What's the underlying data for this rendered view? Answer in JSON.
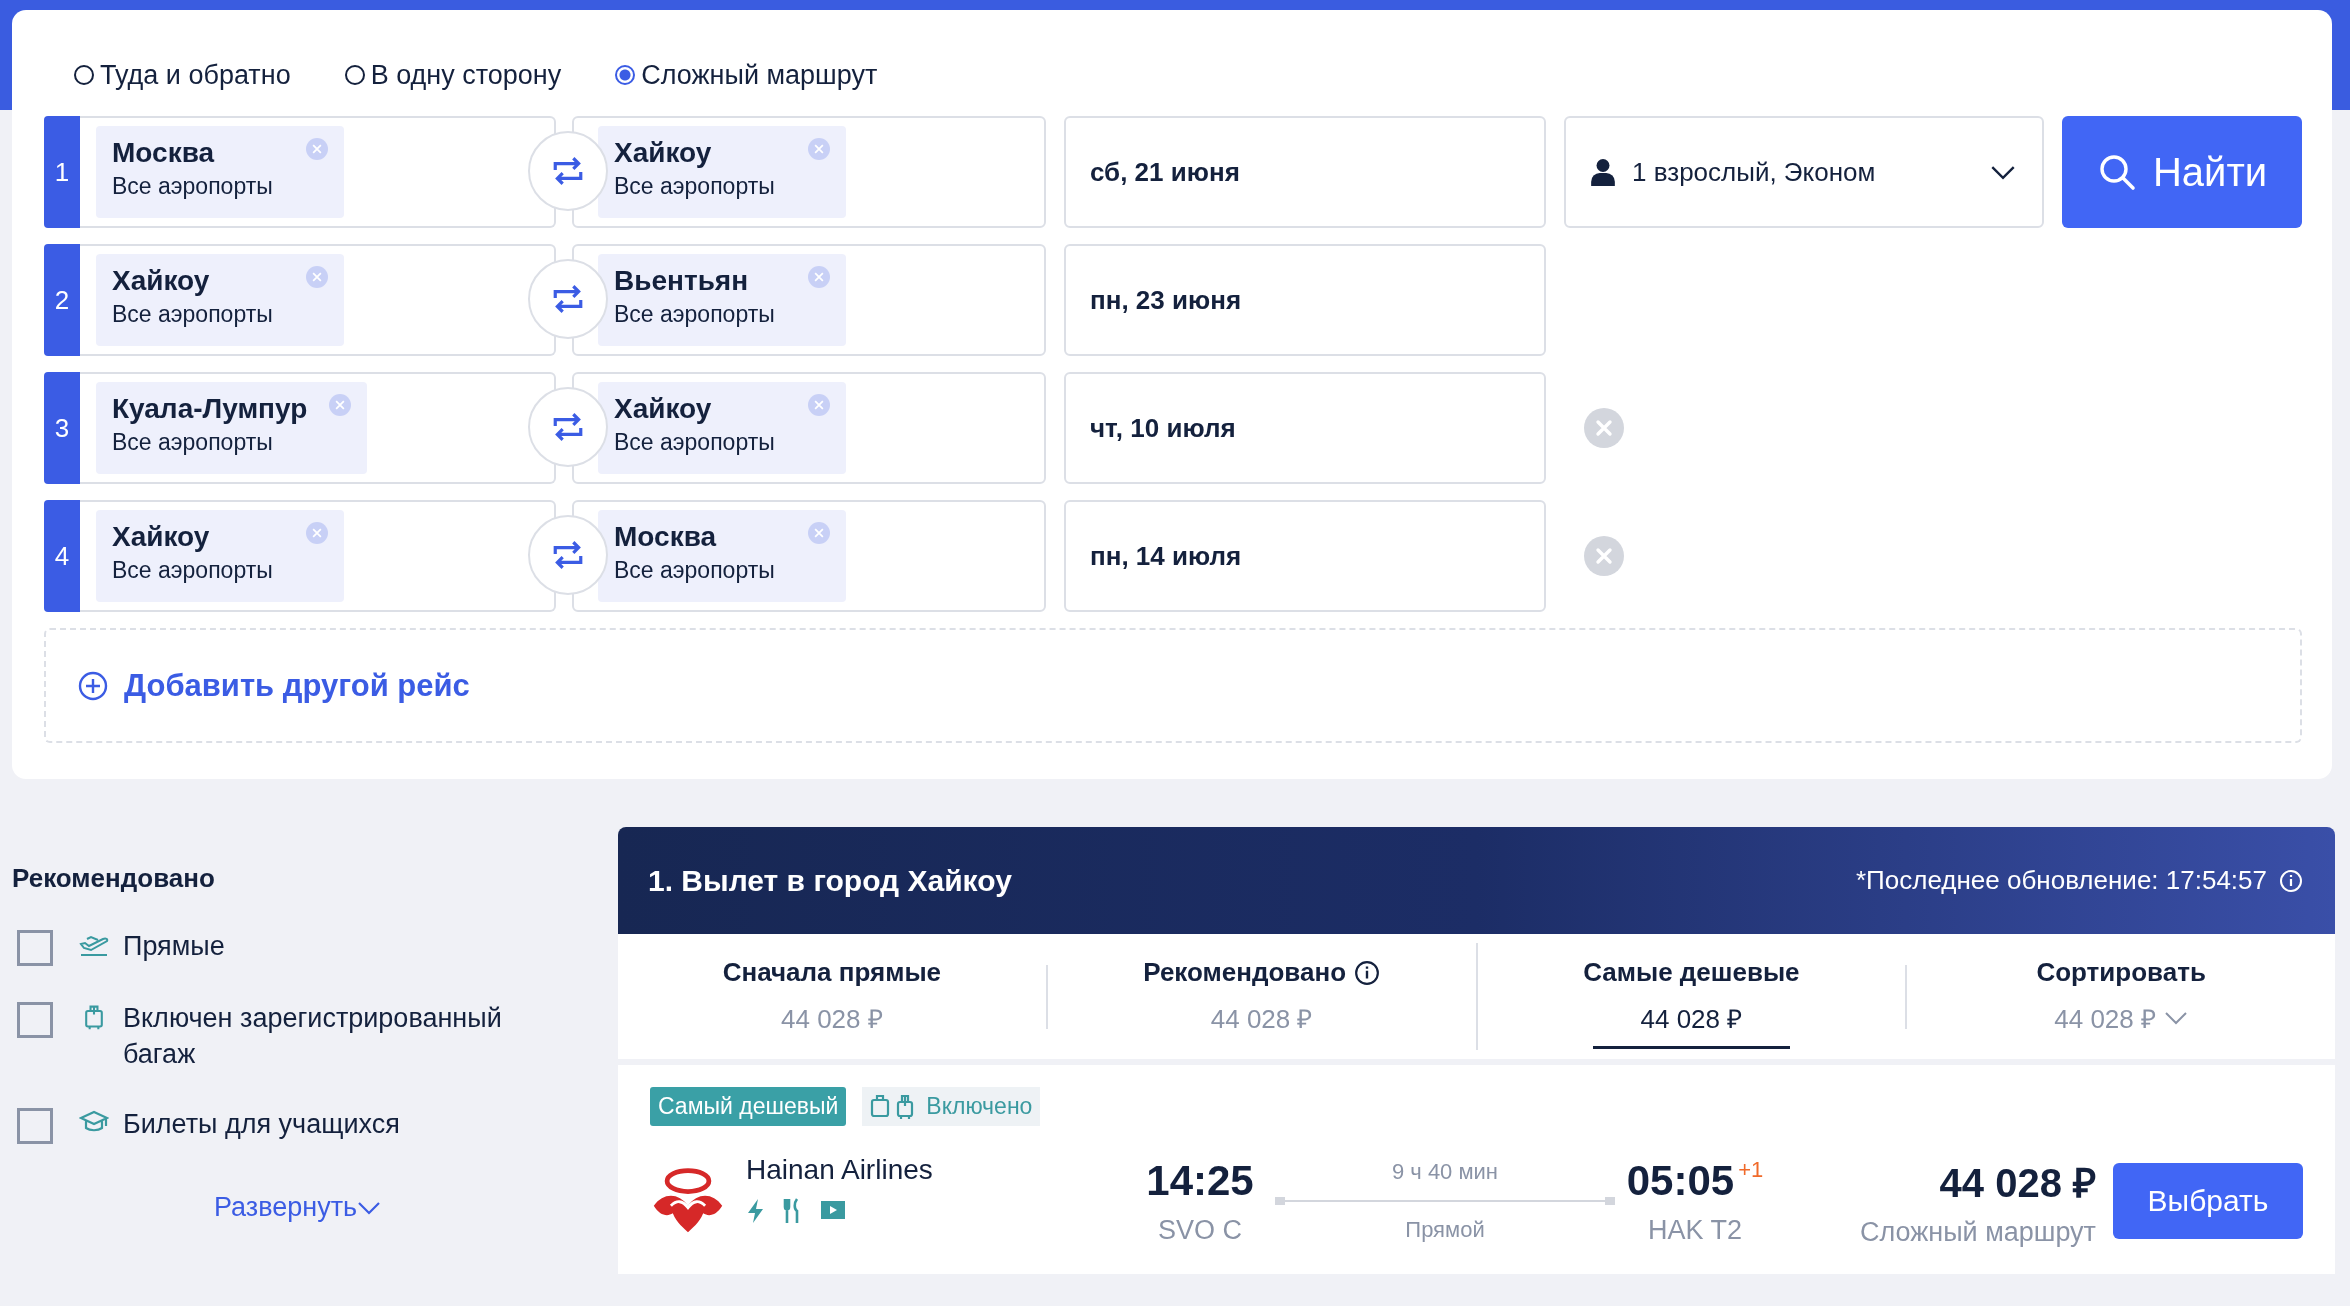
{
  "trip_types": [
    {
      "label": "Туда и обратно",
      "selected": false
    },
    {
      "label": "В одну сторону",
      "selected": false
    },
    {
      "label": "Сложный маршрут",
      "selected": true
    }
  ],
  "legs": [
    {
      "number": "1",
      "from": {
        "city": "Москва",
        "airports": "Все аэропорты"
      },
      "to": {
        "city": "Хайкоу",
        "airports": "Все аэропорты"
      },
      "date": "сб, 21 июня",
      "removable": false
    },
    {
      "number": "2",
      "from": {
        "city": "Хайкоу",
        "airports": "Все аэропорты"
      },
      "to": {
        "city": "Вьентьян",
        "airports": "Все аэропорты"
      },
      "date": "пн, 23 июня",
      "removable": false
    },
    {
      "number": "3",
      "from": {
        "city": "Куала-Лумпур",
        "airports": "Все аэропорты"
      },
      "to": {
        "city": "Хайкоу",
        "airports": "Все аэропорты"
      },
      "date": "чт, 10 июля",
      "removable": true
    },
    {
      "number": "4",
      "from": {
        "city": "Хайкоу",
        "airports": "Все аэропорты"
      },
      "to": {
        "city": "Москва",
        "airports": "Все аэропорты"
      },
      "date": "пн, 14 июля",
      "removable": true
    }
  ],
  "passengers": "1 взрослый, Эконом",
  "search_button": "Найти",
  "add_flight": "Добавить другой рейс",
  "filters": {
    "title": "Рекомендовано",
    "items": [
      {
        "label": "Прямые",
        "checked": false,
        "kind": "direct"
      },
      {
        "label": "Включен зарегистрированный багаж",
        "checked": false,
        "kind": "baggage"
      },
      {
        "label": "Билеты для учащихся",
        "checked": false,
        "kind": "student"
      }
    ],
    "expand": "Развернуть"
  },
  "results": {
    "title": "1. Вылет в город Хайкоу",
    "updated": "*Последнее обновление: 17:54:57",
    "sort_tabs": [
      {
        "label": "Сначала прямые",
        "price": "44 028 ₽",
        "selected": false,
        "kind": "plain"
      },
      {
        "label": "Рекомендовано",
        "price": "44 028 ₽",
        "selected": false,
        "kind": "info"
      },
      {
        "label": "Самые дешевые",
        "price": "44 028 ₽",
        "selected": true,
        "kind": "plain"
      },
      {
        "label": "Сортировать",
        "price": "44 028 ₽",
        "selected": false,
        "kind": "dropdown"
      }
    ],
    "flights": [
      {
        "badge": "Самый дешевый",
        "baggage": "Включено",
        "airline": "Hainan Airlines",
        "depart_time": "14:25",
        "depart_airport": "SVO C",
        "duration": "9 ч 40 мин",
        "stops": "Прямой",
        "arrive_time": "05:05",
        "day_offset": "+1",
        "arrive_airport": "HAK T2",
        "price": "44 028 ₽",
        "route_type": "Сложный маршрут",
        "select_button": "Выбрать"
      }
    ]
  }
}
